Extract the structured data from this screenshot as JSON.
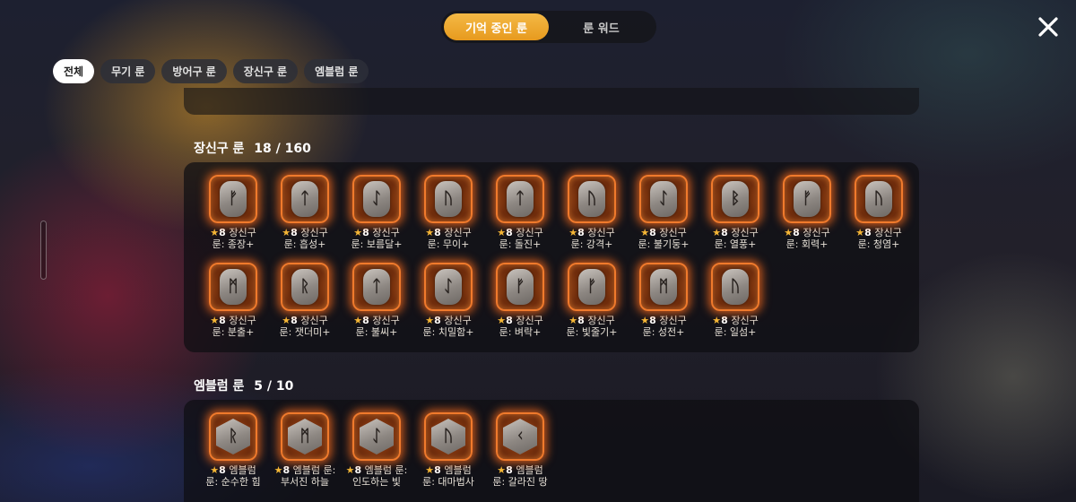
{
  "top_tabs": [
    {
      "label": "기억 중인 룬",
      "active": true
    },
    {
      "label": "룬 워드",
      "active": false
    }
  ],
  "filters": [
    {
      "label": "전체",
      "active": true
    },
    {
      "label": "무기 룬",
      "active": false
    },
    {
      "label": "방어구 룬",
      "active": false
    },
    {
      "label": "장신구 룬",
      "active": false
    },
    {
      "label": "엠블럼 룬",
      "active": false
    }
  ],
  "icons": {
    "close": "close-icon",
    "star": "★"
  },
  "colors": {
    "accent": "#f0a22e",
    "rune_glow": "#f07a2c",
    "star": "#f5b937"
  },
  "sections": [
    {
      "title": "장신구 룬",
      "count": "18 / 160",
      "runes": [
        {
          "level": "★8",
          "type": "장신구",
          "name": "룬: 종장+",
          "glyph": "ᚠ"
        },
        {
          "level": "★8",
          "type": "장신구",
          "name": "룬: 흡성+",
          "glyph": "ᛏ"
        },
        {
          "level": "★8",
          "type": "장신구",
          "name": "룬: 보름달+",
          "glyph": "ᛇ"
        },
        {
          "level": "★8",
          "type": "장신구",
          "name": "룬: 무이+",
          "glyph": "ᚢ"
        },
        {
          "level": "★8",
          "type": "장신구",
          "name": "룬: 돌진+",
          "glyph": "ᛏ"
        },
        {
          "level": "★8",
          "type": "장신구",
          "name": "룬: 강격+",
          "glyph": "ᚢ"
        },
        {
          "level": "★8",
          "type": "장신구",
          "name": "룬: 불기둥+",
          "glyph": "ᛇ"
        },
        {
          "level": "★8",
          "type": "장신구",
          "name": "룬: 열풍+",
          "glyph": "ᛒ"
        },
        {
          "level": "★8",
          "type": "장신구",
          "name": "룬: 회력+",
          "glyph": "ᚠ"
        },
        {
          "level": "★8",
          "type": "장신구",
          "name": "룬: 청염+",
          "glyph": "ᚢ"
        },
        {
          "level": "★8",
          "type": "장신구",
          "name": "룬: 분출+",
          "glyph": "ᛗ"
        },
        {
          "level": "★8",
          "type": "장신구",
          "name": "룬: 잿더미+",
          "glyph": "ᚱ"
        },
        {
          "level": "★8",
          "type": "장신구",
          "name": "룬: 불씨+",
          "glyph": "ᛏ"
        },
        {
          "level": "★8",
          "type": "장신구",
          "name": "룬: 치밀함+",
          "glyph": "ᛇ"
        },
        {
          "level": "★8",
          "type": "장신구",
          "name": "룬: 벼락+",
          "glyph": "ᚠ"
        },
        {
          "level": "★8",
          "type": "장신구",
          "name": "룬: 빛줄기+",
          "glyph": "ᚠ"
        },
        {
          "level": "★8",
          "type": "장신구",
          "name": "룬: 성전+",
          "glyph": "ᛗ"
        },
        {
          "level": "★8",
          "type": "장신구",
          "name": "룬: 일섬+",
          "glyph": "ᚢ"
        }
      ]
    },
    {
      "title": "엠블럼 룬",
      "count": "5 / 10",
      "runes": [
        {
          "level": "★8",
          "type": "엠블럼",
          "name": "룬: 순수한 힘",
          "glyph": "ᚱ"
        },
        {
          "level": "★8",
          "type": "엠블럼 룬:",
          "name": "부서진 하늘",
          "glyph": "ᛗ"
        },
        {
          "level": "★8",
          "type": "엠블럼 룬:",
          "name": "인도하는 빛",
          "glyph": "ᛇ"
        },
        {
          "level": "★8",
          "type": "엠블럼",
          "name": "룬: 대마법사",
          "glyph": "ᚢ"
        },
        {
          "level": "★8",
          "type": "엠블럼",
          "name": "룬: 갈라진 땅",
          "glyph": "ᚲ"
        }
      ]
    }
  ]
}
